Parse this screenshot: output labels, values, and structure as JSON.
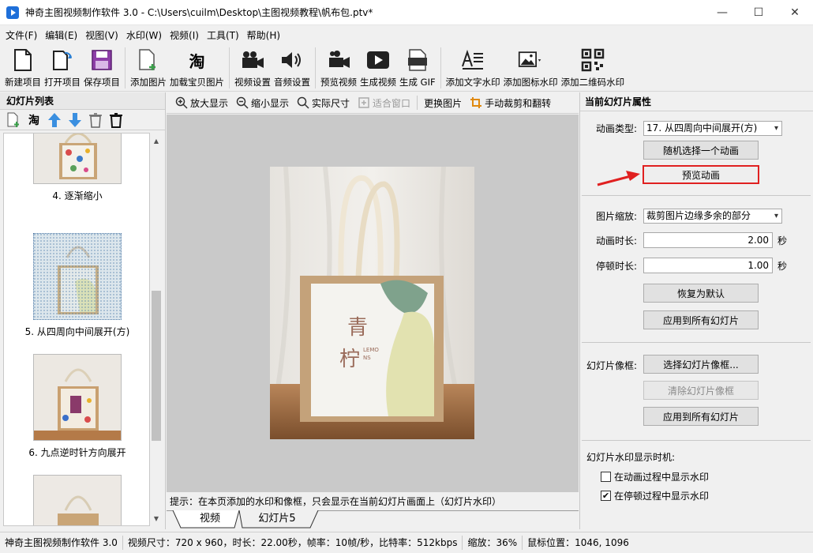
{
  "window": {
    "title": "神奇主图视频制作软件 3.0 - C:\\Users\\cuilm\\Desktop\\主图视频教程\\帆布包.ptv*",
    "min": "—",
    "max": "☐",
    "close": "✕"
  },
  "menu": [
    "文件(F)",
    "编辑(E)",
    "视图(V)",
    "水印(W)",
    "视频(I)",
    "工具(T)",
    "帮助(H)"
  ],
  "toolbar": {
    "new": "新建项目",
    "open": "打开项目",
    "save": "保存项目",
    "add_image": "添加图片",
    "load_taobao": "加载宝贝图片",
    "video_settings": "视频设置",
    "audio_settings": "音频设置",
    "preview_video": "预览视频",
    "generate_video": "生成视频",
    "generate_gif": "生成 GIF",
    "text_watermark": "添加文字水印",
    "icon_watermark": "添加图标水印",
    "qr_watermark": "添加二维码水印",
    "gif_badge": "GIF",
    "taobao_glyph": "淘"
  },
  "left_panel": {
    "title": "幻灯片列表",
    "taobao_glyph": "淘",
    "slides": [
      {
        "label": "4. 逐渐缩小"
      },
      {
        "label": "5. 从四周向中间展开(方)"
      },
      {
        "label": "6. 九点逆时针方向展开"
      }
    ]
  },
  "center": {
    "zoom_in": "放大显示",
    "zoom_out": "缩小显示",
    "actual_size": "实际尺寸",
    "fit_window": "适合窗口",
    "change_image": "更换图片",
    "manual_crop": "手动裁剪和翻转",
    "hint": "提示：在本页添加的水印和像框，只会显示在当前幻灯片画面上（幻灯片水印）",
    "tabs": [
      "视频",
      "幻灯片5"
    ],
    "bag_text_1": "青",
    "bag_text_2": "柠",
    "bag_text_3": "LEMO",
    "bag_text_4": "NS"
  },
  "right_panel": {
    "title": "当前幻灯片属性",
    "animation_type_label": "动画类型:",
    "animation_type_value": "17. 从四周向中间展开(方)",
    "random_button": "随机选择一个动画",
    "preview_button": "预览动画",
    "scale_label": "图片缩放:",
    "scale_value": "裁剪图片边缘多余的部分",
    "anim_duration_label": "动画时长:",
    "anim_duration_value": "2.00",
    "pause_duration_label": "停顿时长:",
    "pause_duration_value": "1.00",
    "seconds": "秒",
    "reset_button": "恢复为默认",
    "apply_all_button": "应用到所有幻灯片",
    "frame_label": "幻灯片像框:",
    "select_frame_button": "选择幻灯片像框...",
    "clear_frame_button": "清除幻灯片像框",
    "apply_frame_button": "应用到所有幻灯片",
    "watermark_timing_label": "幻灯片水印显示时机:",
    "during_animation": "在动画过程中显示水印",
    "during_pause": "在停顿过程中显示水印",
    "during_animation_checked": false,
    "during_pause_checked": true
  },
  "status": {
    "app": "神奇主图视频制作软件 3.0",
    "video_info": "视频尺寸：720 x 960，时长：22.00秒，帧率：10帧/秒，比特率：512kbps",
    "zoom": "缩放：36%",
    "mouse": "鼠标位置：1046, 1096"
  },
  "colors": {
    "accent_red": "#e02020",
    "arrow_blue": "#3a8fe0"
  }
}
